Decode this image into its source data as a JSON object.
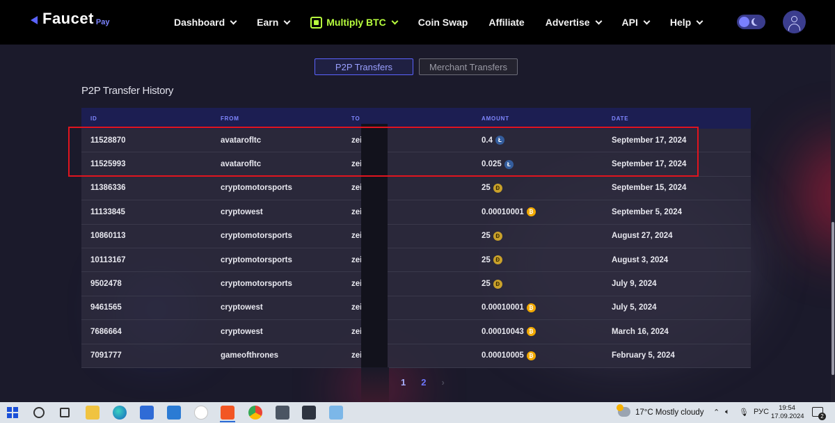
{
  "header": {
    "logo_text": "Faucet",
    "logo_sub": "Pay",
    "nav": [
      {
        "label": "Dashboard",
        "dropdown": true
      },
      {
        "label": "Earn",
        "dropdown": true
      },
      {
        "label": "Multiply BTC",
        "dropdown": true,
        "active": true
      },
      {
        "label": "Coin Swap",
        "dropdown": false
      },
      {
        "label": "Affiliate",
        "dropdown": false
      },
      {
        "label": "Advertise",
        "dropdown": true
      },
      {
        "label": "API",
        "dropdown": true
      },
      {
        "label": "Help",
        "dropdown": true
      }
    ],
    "accent_color": "#b8ff3e"
  },
  "tabs": {
    "p2p": "P2P Transfers",
    "merchant": "Merchant Transfers"
  },
  "section_title": "P2P Transfer History",
  "table": {
    "columns": [
      "ID",
      "FROM",
      "TO",
      "AMOUNT",
      "DATE"
    ],
    "rows": [
      {
        "id": "11528870",
        "from": "avatarofltc",
        "to": "zei",
        "amount": "0.4",
        "coin": "ltc",
        "date": "September 17, 2024"
      },
      {
        "id": "11525993",
        "from": "avatarofltc",
        "to": "zei",
        "amount": "0.025",
        "coin": "ltc",
        "date": "September 17, 2024"
      },
      {
        "id": "11386336",
        "from": "cryptomotorsports",
        "to": "zei",
        "amount": "25",
        "coin": "doge",
        "date": "September 15, 2024"
      },
      {
        "id": "11133845",
        "from": "cryptowest",
        "to": "zei",
        "amount": "0.00010001",
        "coin": "btc",
        "date": "September 5, 2024"
      },
      {
        "id": "10860113",
        "from": "cryptomotorsports",
        "to": "zei",
        "amount": "25",
        "coin": "doge",
        "date": "August 27, 2024"
      },
      {
        "id": "10113167",
        "from": "cryptomotorsports",
        "to": "zei",
        "amount": "25",
        "coin": "doge",
        "date": "August 3, 2024"
      },
      {
        "id": "9502478",
        "from": "cryptomotorsports",
        "to": "zei",
        "amount": "25",
        "coin": "doge",
        "date": "July 9, 2024"
      },
      {
        "id": "9461565",
        "from": "cryptowest",
        "to": "zei",
        "amount": "0.00010001",
        "coin": "btc",
        "date": "July 5, 2024"
      },
      {
        "id": "7686664",
        "from": "cryptowest",
        "to": "zei",
        "amount": "0.00010043",
        "coin": "btc",
        "date": "March 16, 2024"
      },
      {
        "id": "7091777",
        "from": "gameofthrones",
        "to": "zei",
        "amount": "0.00010005",
        "coin": "btc",
        "date": "February 5, 2024"
      }
    ]
  },
  "pagination": {
    "pages": [
      "1",
      "2"
    ],
    "next": "›"
  },
  "taskbar": {
    "weather": "17°C  Mostly cloudy",
    "lang": "РУС",
    "time": "19:54",
    "date": "17.09.2024",
    "notifications": "2"
  }
}
